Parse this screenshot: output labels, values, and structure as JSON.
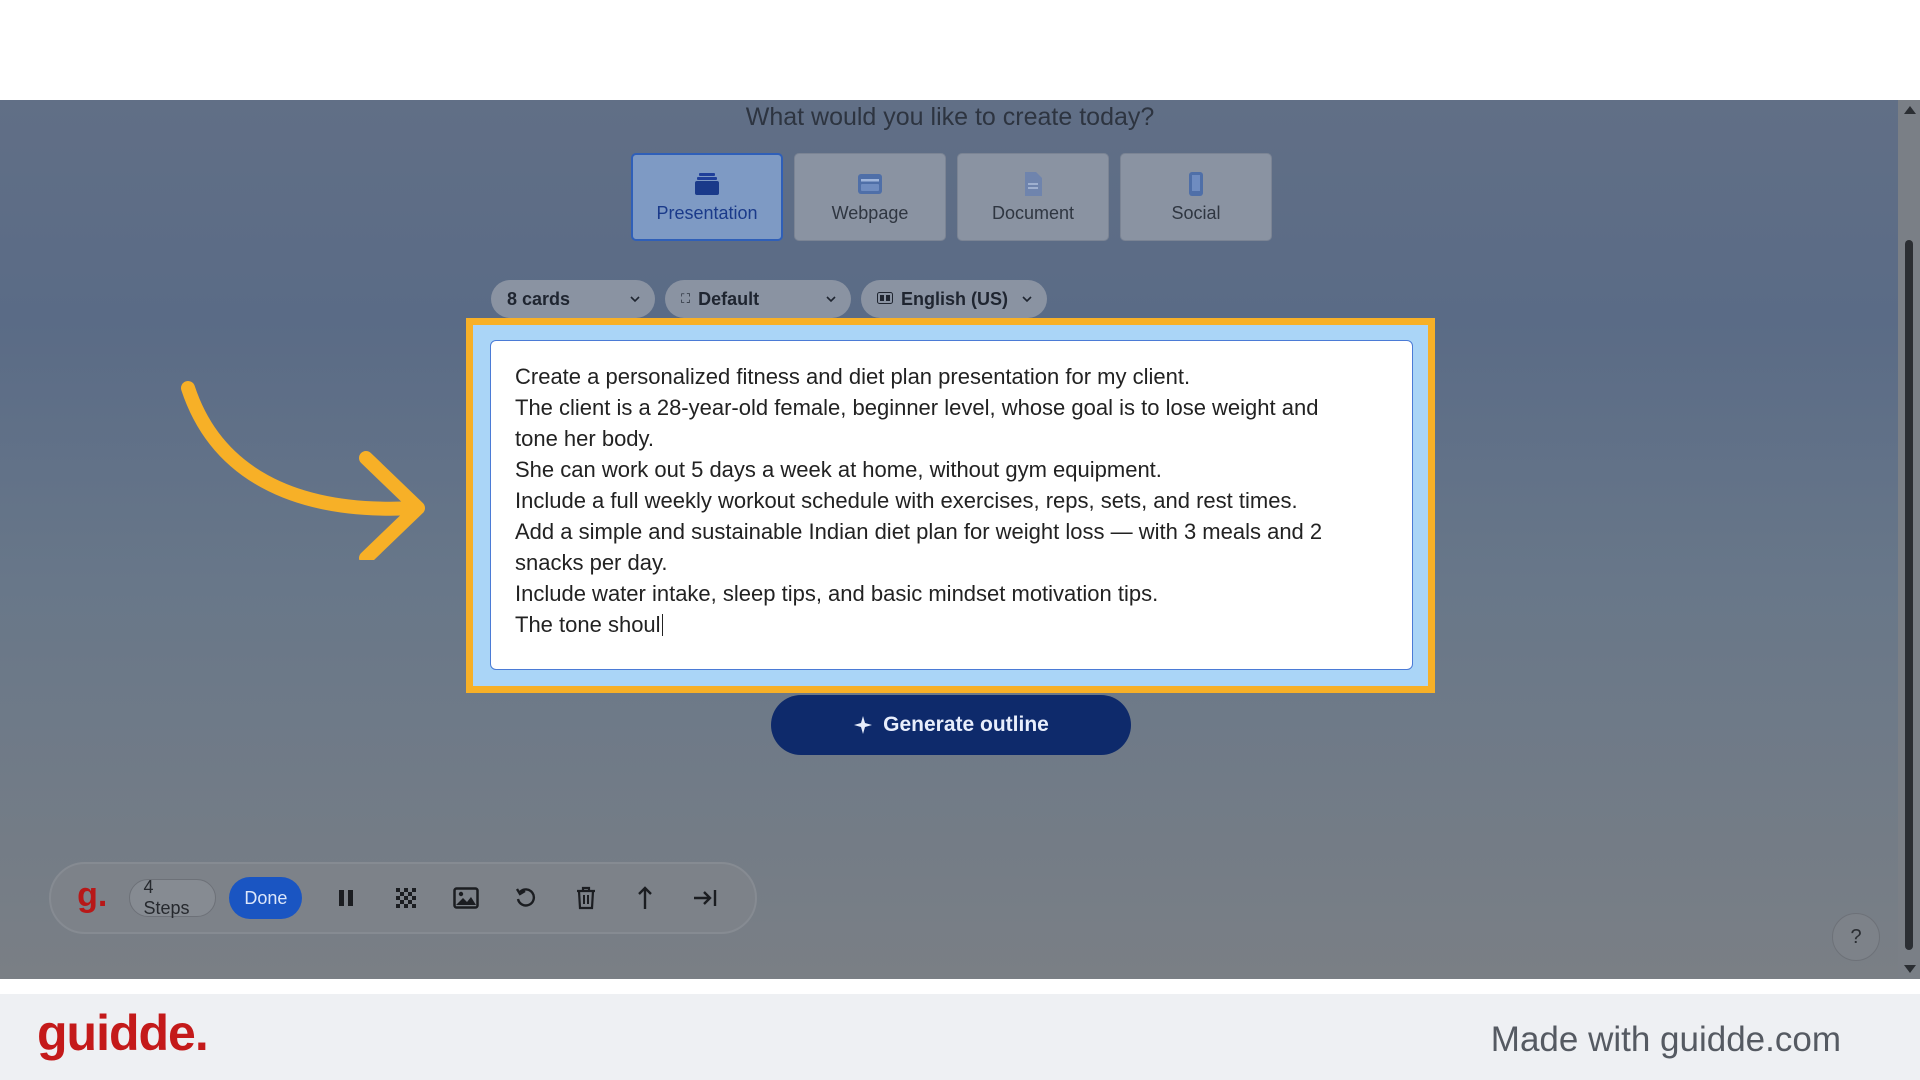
{
  "headline": "What would you like to create today?",
  "content_types": [
    {
      "label": "Presentation",
      "icon": "presentation-icon",
      "active": true
    },
    {
      "label": "Webpage",
      "icon": "webpage-icon",
      "active": false
    },
    {
      "label": "Document",
      "icon": "document-icon",
      "active": false
    },
    {
      "label": "Social",
      "icon": "phone-icon",
      "active": false
    }
  ],
  "options": {
    "cards": "8 cards",
    "theme": "Default",
    "language": "English (US)"
  },
  "prompt_lines": [
    "Create a personalized fitness and diet plan presentation for my client.",
    "The client is a 28-year-old female, beginner level, whose goal is to lose weight and",
    "tone her body.",
    "She can work out 5 days a week at home, without gym equipment.",
    "Include a full weekly workout schedule with exercises, reps, sets, and rest times.",
    "Add a simple and sustainable Indian diet plan for weight loss — with 3 meals and 2",
    "snacks per day.",
    "Include water intake, sleep tips, and basic mindset motivation tips.",
    "The tone shoul"
  ],
  "generate_button": "Generate outline",
  "recorder": {
    "logo": "g.",
    "steps": "4 Steps",
    "done": "Done",
    "tools": [
      "pause-icon",
      "blur-icon",
      "image-icon",
      "undo-icon",
      "trash-icon",
      "upload-icon",
      "skip-icon"
    ]
  },
  "help": "?",
  "footer": {
    "brand": "guidde.",
    "made_with": "Made with guidde.com"
  },
  "colors": {
    "highlight": "#f7b027",
    "primary_button": "#0e2a6b",
    "brand_red": "#c41a1a",
    "done_blue": "#1a55c2"
  }
}
